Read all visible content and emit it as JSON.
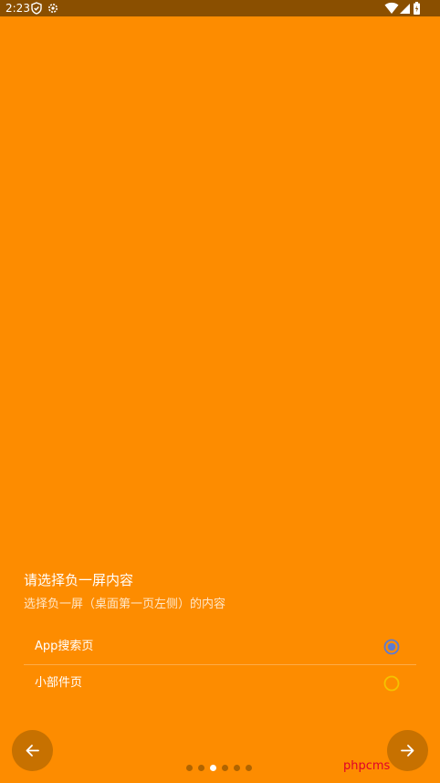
{
  "status_bar": {
    "time": "2:23",
    "left_icons": [
      "shield-check-icon",
      "gear-icon"
    ],
    "right_icons": [
      "wifi-icon",
      "signal-icon",
      "battery-icon"
    ]
  },
  "page": {
    "title": "请选择负一屏内容",
    "subtitle": "选择负一屏（桌面第一页左侧）的内容"
  },
  "options": [
    {
      "label": "App搜索页",
      "selected": true
    },
    {
      "label": "小部件页",
      "selected": false
    }
  ],
  "navigation": {
    "back_icon": "arrow-left-icon",
    "next_icon": "arrow-right-icon"
  },
  "pager": {
    "count": 6,
    "active_index": 2
  },
  "watermark": {
    "text": "phpcms"
  },
  "colors": {
    "background": "#FD8C00",
    "status_bar": "#8A4F00",
    "nav_button": "#C77100",
    "radio_selected": "#5E7BD1",
    "radio_unselected": "#F5C200",
    "watermark": "#E0002A"
  }
}
